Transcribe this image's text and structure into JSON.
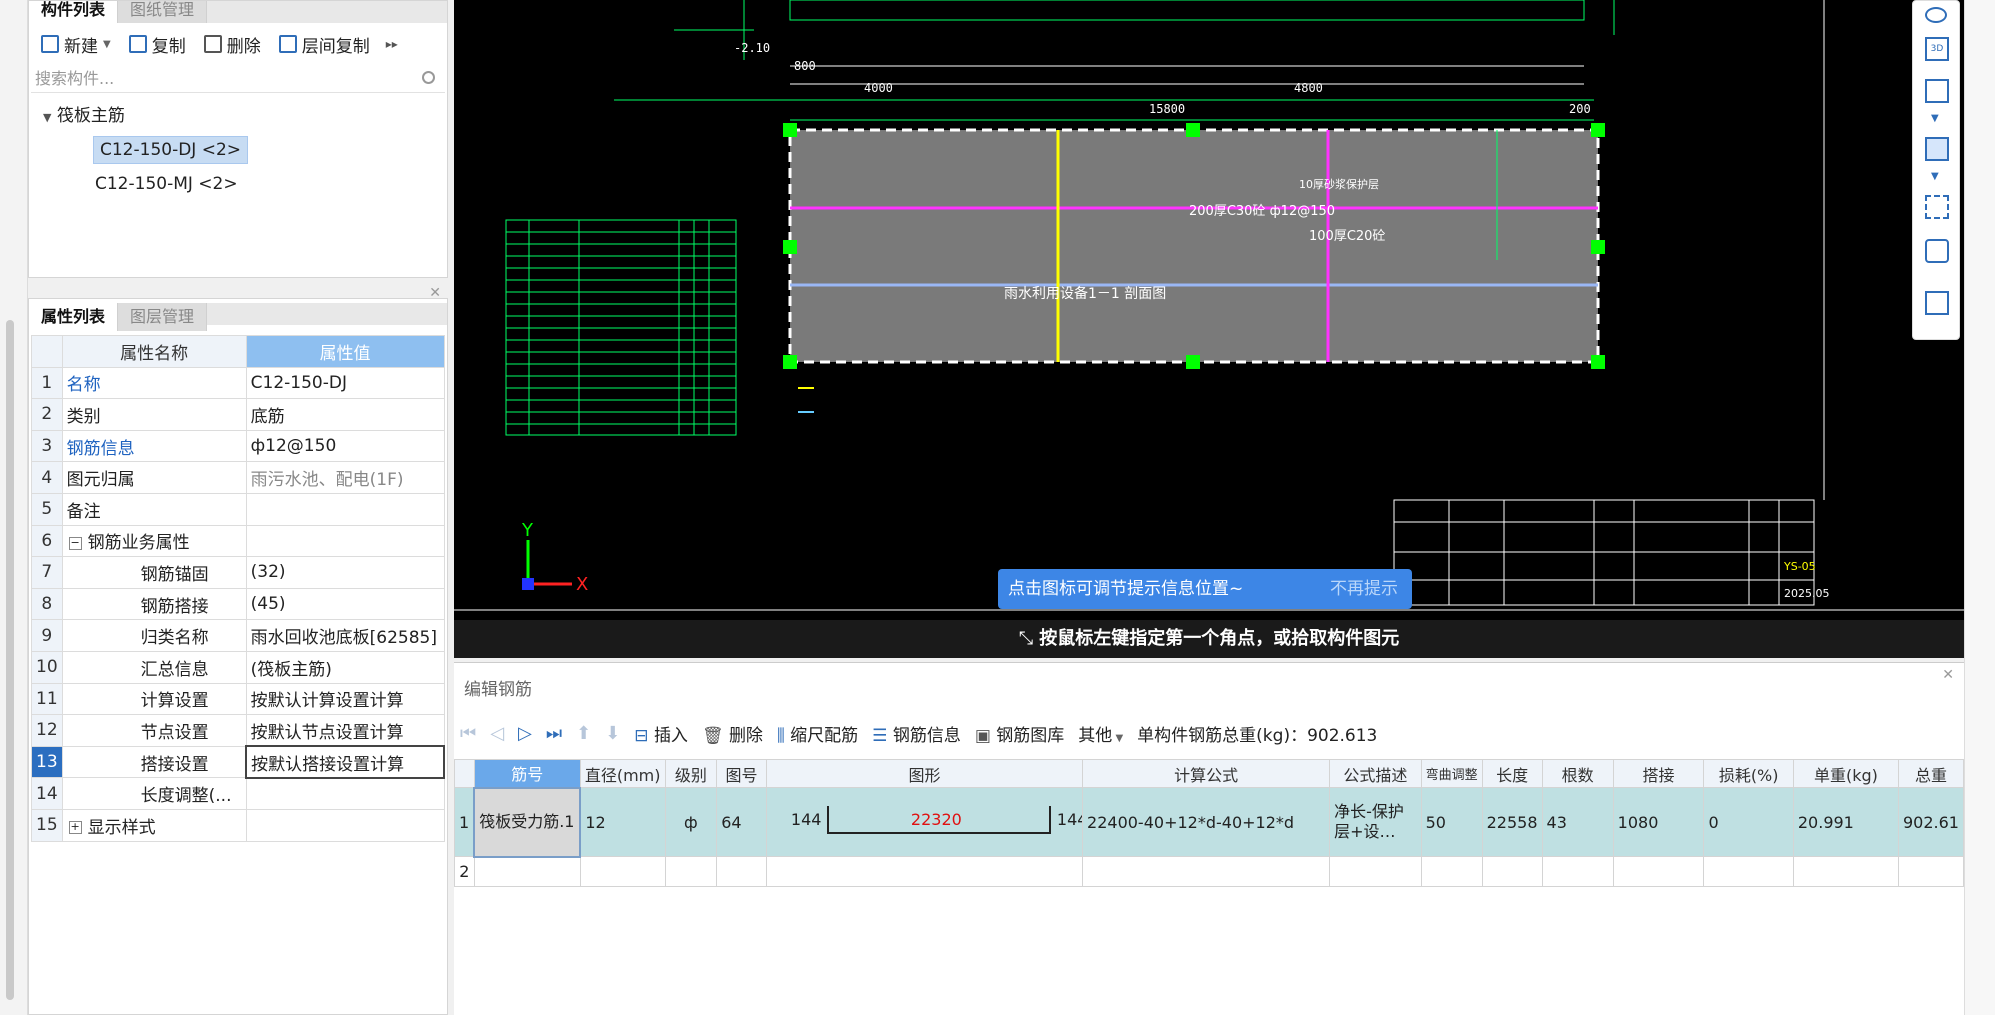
{
  "component_panel": {
    "tabs": [
      "构件列表",
      "图纸管理"
    ],
    "toolbar": {
      "new": "新建",
      "copy": "复制",
      "delete": "删除",
      "floor_copy": "层间复制"
    },
    "search_placeholder": "搜索构件...",
    "tree": {
      "root": "筏板主筋",
      "items": [
        "C12-150-DJ <2>",
        "C12-150-MJ <2>"
      ]
    }
  },
  "property_panel": {
    "tabs": [
      "属性列表",
      "图层管理"
    ],
    "headers": {
      "name": "属性名称",
      "value": "属性值"
    },
    "rows": [
      {
        "n": "1",
        "name": "名称",
        "value": "C12-150-DJ"
      },
      {
        "n": "2",
        "name": "类别",
        "value": "底筋"
      },
      {
        "n": "3",
        "name": "钢筋信息",
        "value": "ф12@150"
      },
      {
        "n": "4",
        "name": "图元归属",
        "value": "雨污水池、配电(1F)"
      },
      {
        "n": "5",
        "name": "备注",
        "value": ""
      },
      {
        "n": "6",
        "name": "钢筋业务属性",
        "value": ""
      },
      {
        "n": "7",
        "name": "钢筋锚固",
        "value": "(32)"
      },
      {
        "n": "8",
        "name": "钢筋搭接",
        "value": "(45)"
      },
      {
        "n": "9",
        "name": "归类名称",
        "value": "雨水回收池底板[62585]"
      },
      {
        "n": "10",
        "name": "汇总信息",
        "value": "(筏板主筋)"
      },
      {
        "n": "11",
        "name": "计算设置",
        "value": "按默认计算设置计算"
      },
      {
        "n": "12",
        "name": "节点设置",
        "value": "按默认节点设置计算"
      },
      {
        "n": "13",
        "name": "搭接设置",
        "value": "按默认搭接设置计算"
      },
      {
        "n": "14",
        "name": "长度调整(...",
        "value": ""
      },
      {
        "n": "15",
        "name": "显示样式",
        "value": ""
      }
    ]
  },
  "canvas": {
    "section_title": "雨水利用设备1－1 剖面图",
    "labels": [
      "200厚C30砼 ф12@150",
      "100厚C20砼",
      "10厚砂浆保护层"
    ],
    "dims_top": [
      "800",
      "4000",
      "4800",
      "15800",
      "200"
    ],
    "elevation": "-2.10",
    "tip": "点击图标可调节提示信息位置~",
    "tip_dismiss": "不再提示",
    "status": "按鼠标左键指定第一个角点，或拾取构件图元",
    "axis_y": "Y",
    "axis_x": "X",
    "title_block_code": "YS-05",
    "title_block_date": "2025.05"
  },
  "edit_rebar": {
    "title": "编辑钢筋",
    "toolbar": {
      "insert": "插入",
      "delete": "删除",
      "scale": "缩尺配筋",
      "info": "钢筋信息",
      "lib": "钢筋图库",
      "other": "其他",
      "total_label": "单构件钢筋总重(kg)：",
      "total": "902.613"
    },
    "headers": [
      "筋号",
      "直径(mm)",
      "级别",
      "图号",
      "图形",
      "计算公式",
      "公式描述",
      "弯曲调整",
      "长度",
      "根数",
      "搭接",
      "损耗(%)",
      "单重(kg)",
      "总重"
    ],
    "row": {
      "n": "1",
      "name": "筏板受力筋.1",
      "diameter": "12",
      "grade": "ф",
      "fig": "64",
      "shape_left": "144",
      "shape_mid": "22320",
      "shape_right": "144",
      "formula": "22400-40+12*d-40+12*d",
      "desc": "净长-保护层+设…",
      "bend": "50",
      "length": "22558",
      "count": "43",
      "lap": "1080",
      "loss": "0",
      "unit_w": "20.991",
      "total_w": "902.61"
    },
    "row2_n": "2"
  },
  "colors": {
    "accent": "#2b6ec0",
    "header_blue": "#8ebff0",
    "row_teal": "#bfe0e2"
  }
}
